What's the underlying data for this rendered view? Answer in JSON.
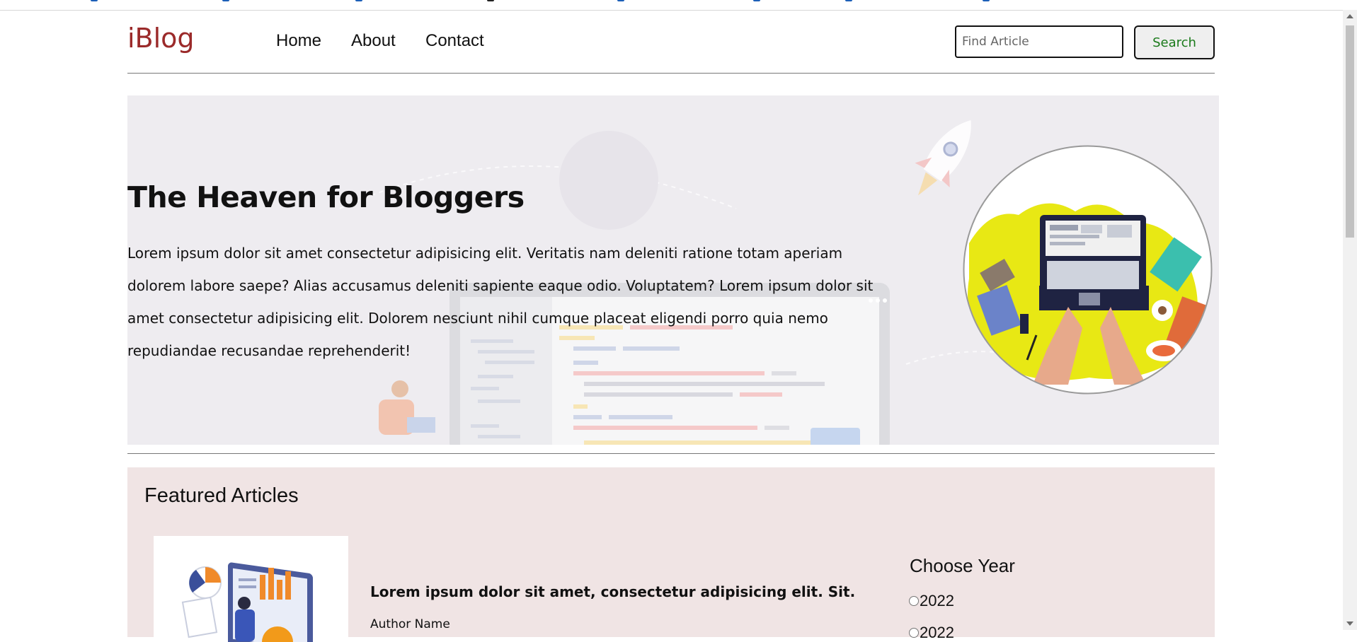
{
  "nav": {
    "logo": "iBlog",
    "links": [
      "Home",
      "About",
      "Contact"
    ],
    "search_placeholder": "Find Article",
    "search_button": "Search"
  },
  "hero": {
    "title": "The Heaven for Bloggers",
    "text": "Lorem ipsum dolor sit amet consectetur adipisicing elit. Veritatis nam deleniti ratione totam aperiam dolorem labore saepe? Alias accusamus deleniti sapiente eaque odio. Voluptatem? Lorem ipsum dolor sit amet consectetur adipisicing elit. Dolorem nesciunt nihil cumque placeat eligendi porro quia nemo repudiandae recusandae reprehenderit!"
  },
  "featured": {
    "heading": "Featured Articles",
    "article": {
      "title": "Lorem ipsum dolor sit amet, consectetur adipisicing elit. Sit.",
      "author": "Author Name"
    },
    "year_filter": {
      "heading": "Choose Year",
      "options": [
        "2022",
        "2022"
      ]
    }
  },
  "colors": {
    "logo": "#9b2a2a",
    "search_button_text": "#1a7a1a",
    "hero_background": "#eeecf0",
    "featured_background": "#f0e4e4"
  }
}
